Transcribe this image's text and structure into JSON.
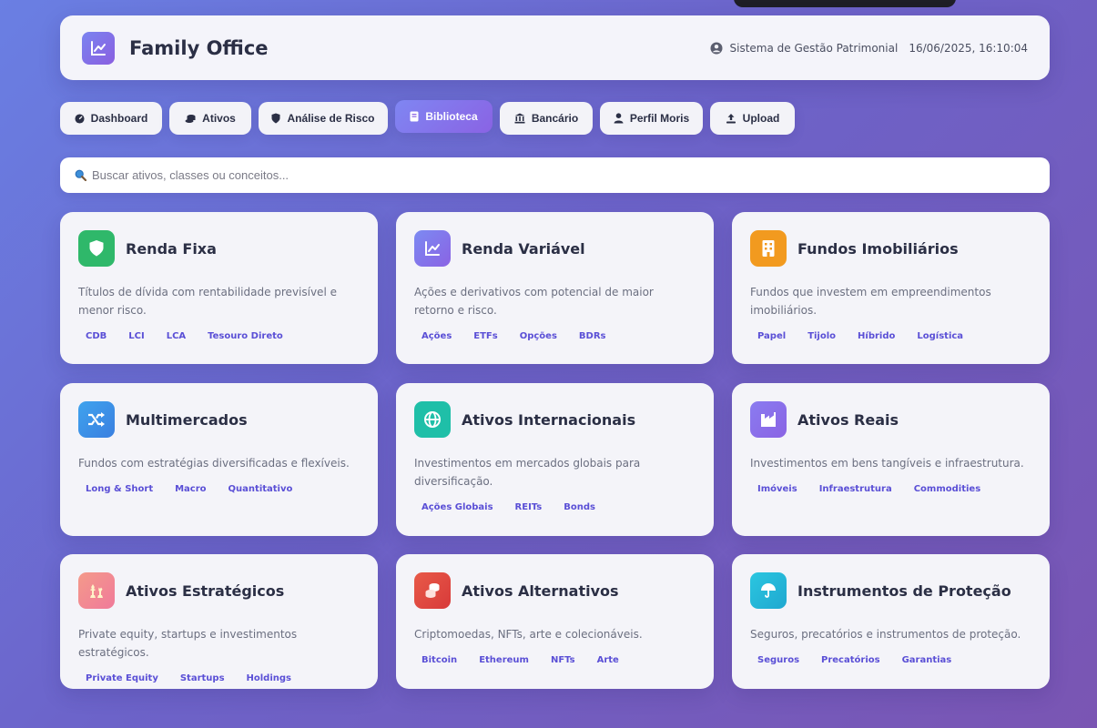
{
  "header": {
    "title": "Family Office",
    "system_label": "Sistema de Gestão Patrimonial",
    "datetime": "16/06/2025, 16:10:04"
  },
  "nav": {
    "tabs": [
      {
        "label": "Dashboard",
        "icon": "gauge-icon",
        "active": false
      },
      {
        "label": "Ativos",
        "icon": "coins-icon",
        "active": false
      },
      {
        "label": "Análise de Risco",
        "icon": "shield-icon",
        "active": false
      },
      {
        "label": "Biblioteca",
        "icon": "book-icon",
        "active": true
      },
      {
        "label": "Bancário",
        "icon": "bank-icon",
        "active": false
      },
      {
        "label": "Perfil Moris",
        "icon": "user-icon",
        "active": false
      },
      {
        "label": "Upload",
        "icon": "upload-icon",
        "active": false
      }
    ]
  },
  "search": {
    "placeholder": "Buscar ativos, classes ou conceitos..."
  },
  "cards": [
    {
      "title": "Renda Fixa",
      "icon": "shield-icon",
      "color": "#2fb86a",
      "description": "Títulos de dívida com rentabilidade previsível e menor risco.",
      "tags": [
        "CDB",
        "LCI",
        "LCA",
        "Tesouro Direto"
      ]
    },
    {
      "title": "Renda Variável",
      "icon": "chart-line-icon",
      "color": "#7c7ff0",
      "description": "Ações e derivativos com potencial de maior retorno e risco.",
      "tags": [
        "Ações",
        "ETFs",
        "Opções",
        "BDRs"
      ]
    },
    {
      "title": "Fundos Imobiliários",
      "icon": "building-icon",
      "color": "#f29a1f",
      "description": "Fundos que investem em empreendimentos imobiliários.",
      "tags": [
        "Papel",
        "Tijolo",
        "Híbrido",
        "Logística"
      ]
    },
    {
      "title": "Multimercados",
      "icon": "shuffle-icon",
      "color": "#3f9ae8",
      "description": "Fundos com estratégias diversificadas e flexíveis.",
      "tags": [
        "Long & Short",
        "Macro",
        "Quantitativo"
      ]
    },
    {
      "title": "Ativos Internacionais",
      "icon": "globe-icon",
      "color": "#1fbfa8",
      "description": "Investimentos em mercados globais para diversificação.",
      "tags": [
        "Ações Globais",
        "REITs",
        "Bonds"
      ]
    },
    {
      "title": "Ativos Reais",
      "icon": "industry-icon",
      "color": "#8a72ea",
      "description": "Investimentos em bens tangíveis e infraestrutura.",
      "tags": [
        "Imóveis",
        "Infraestrutura",
        "Commodities"
      ]
    },
    {
      "title": "Ativos Estratégicos",
      "icon": "chess-icon",
      "color": "#f08a8a",
      "description": "Private equity, startups e investimentos estratégicos.",
      "tags": [
        "Private Equity",
        "Startups",
        "Holdings"
      ]
    },
    {
      "title": "Ativos Alternativos",
      "icon": "coins-stack-icon",
      "color": "#e0463e",
      "description": "Criptomoedas, NFTs, arte e colecionáveis.",
      "tags": [
        "Bitcoin",
        "Ethereum",
        "NFTs",
        "Arte"
      ]
    },
    {
      "title": "Instrumentos de Proteção",
      "icon": "umbrella-icon",
      "color": "#22b8d6",
      "description": "Seguros, precatórios e instrumentos de proteção.",
      "tags": [
        "Seguros",
        "Precatórios",
        "Garantias"
      ]
    }
  ]
}
